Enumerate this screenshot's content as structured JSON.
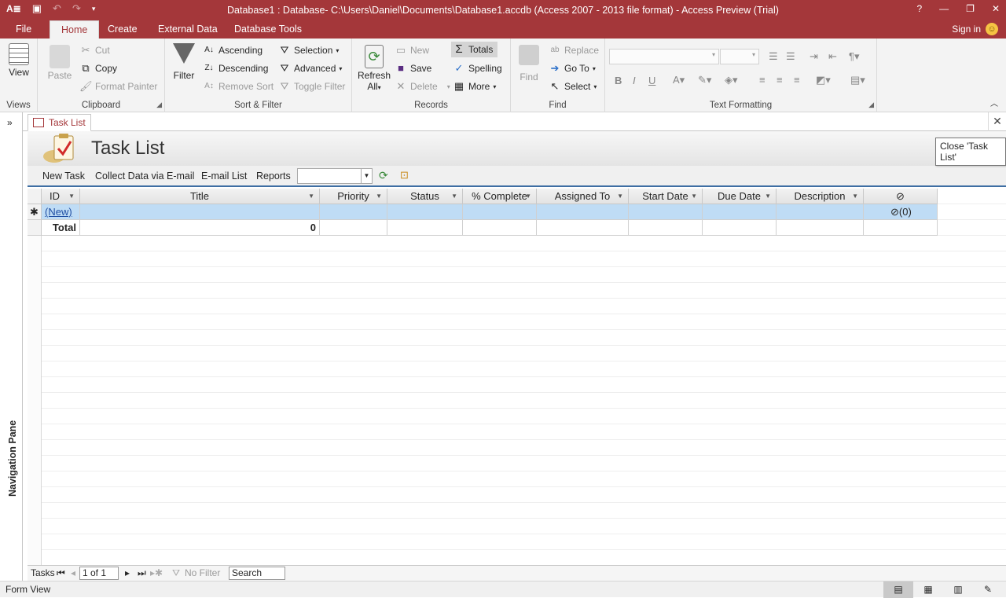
{
  "titlebar": {
    "title": "Database1 : Database- C:\\Users\\Daniel\\Documents\\Database1.accdb (Access 2007 - 2013 file format) - Access Preview (Trial)",
    "help": "?",
    "min": "—",
    "restore": "❐",
    "close": "✕"
  },
  "qat": {
    "app": "A≣",
    "save": "💾",
    "undo": "↶",
    "redo": "↷",
    "customize": "▾"
  },
  "ribbon_tabs": {
    "file": "File",
    "home": "Home",
    "create": "Create",
    "external": "External Data",
    "dbtools": "Database Tools"
  },
  "signin": "Sign in",
  "groups": {
    "views": {
      "label": "Views",
      "view": "View"
    },
    "clipboard": {
      "label": "Clipboard",
      "paste": "Paste",
      "cut": "Cut",
      "copy": "Copy",
      "format_painter": "Format Painter"
    },
    "sort": {
      "label": "Sort & Filter",
      "filter": "Filter",
      "ascending": "Ascending",
      "descending": "Descending",
      "remove_sort": "Remove Sort",
      "selection": "Selection",
      "advanced": "Advanced",
      "toggle_filter": "Toggle Filter"
    },
    "records": {
      "label": "Records",
      "refresh": "Refresh",
      "refresh2": "All",
      "new": "New",
      "save": "Save",
      "delete": "Delete",
      "totals": "Totals",
      "spelling": "Spelling",
      "more": "More"
    },
    "find": {
      "label": "Find",
      "find": "Find",
      "replace": "Replace",
      "goto": "Go To",
      "select": "Select"
    },
    "text": {
      "label": "Text Formatting",
      "bold": "B",
      "italic": "I",
      "underline": "U"
    }
  },
  "nav_pane": {
    "label": "Navigation Pane",
    "toggle": "»"
  },
  "doc_tab": {
    "label": "Task List",
    "tooltip": "Close 'Task List'"
  },
  "form": {
    "title": "Task List",
    "commands": [
      "New Task",
      "Collect Data via E-mail",
      "E-mail List",
      "Reports"
    ]
  },
  "table": {
    "columns": [
      "ID",
      "Title",
      "Priority",
      "Status",
      "% Complete",
      "Assigned To",
      "Start Date",
      "Due Date",
      "Description"
    ],
    "attach_header": "📎",
    "new_row": {
      "marker": "✱",
      "id": "(New)",
      "attach": "(0)"
    },
    "total_row": {
      "label": "Total",
      "title_total": "0"
    }
  },
  "record_nav": {
    "label": "Tasks",
    "position": "1 of 1",
    "filter": "No Filter",
    "search": "Search"
  },
  "status": {
    "text": "Form View"
  },
  "colors": {
    "accent": "#a4373a",
    "selection": "#bfdcf5"
  }
}
